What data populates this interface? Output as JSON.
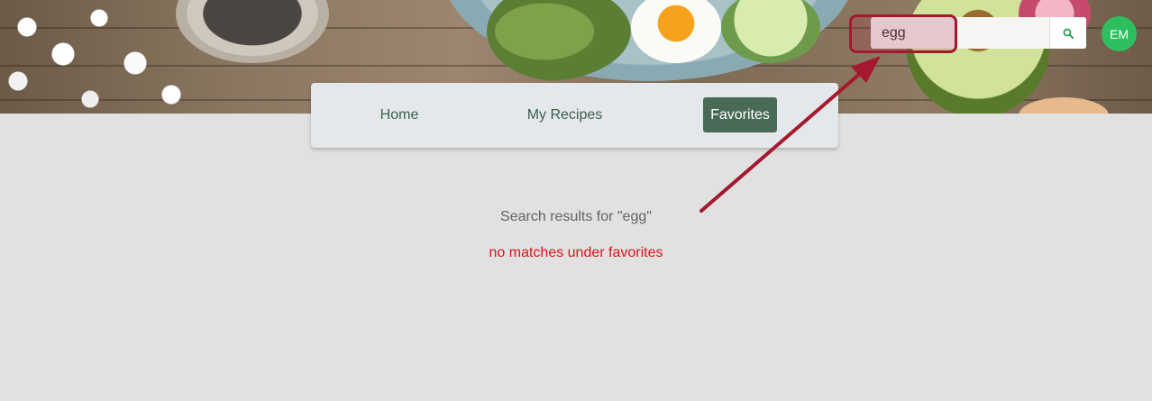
{
  "header": {
    "search": {
      "value": "egg",
      "placeholder": ""
    },
    "search_icon": "search-icon",
    "avatar_initials": "EM"
  },
  "nav": {
    "items": [
      {
        "label": "Home",
        "active": false
      },
      {
        "label": "My Recipes",
        "active": false
      },
      {
        "label": "Favorites",
        "active": true
      }
    ]
  },
  "results": {
    "title": "Search results for \"egg\"",
    "message": "no matches under favorites"
  },
  "colors": {
    "accent_green": "#496a55",
    "nav_text": "#3e5f4b",
    "avatar_bg": "#2dbf5d",
    "error_red": "#e0121c",
    "annotation_red": "#a5182f",
    "background": "#e1e1e1"
  }
}
